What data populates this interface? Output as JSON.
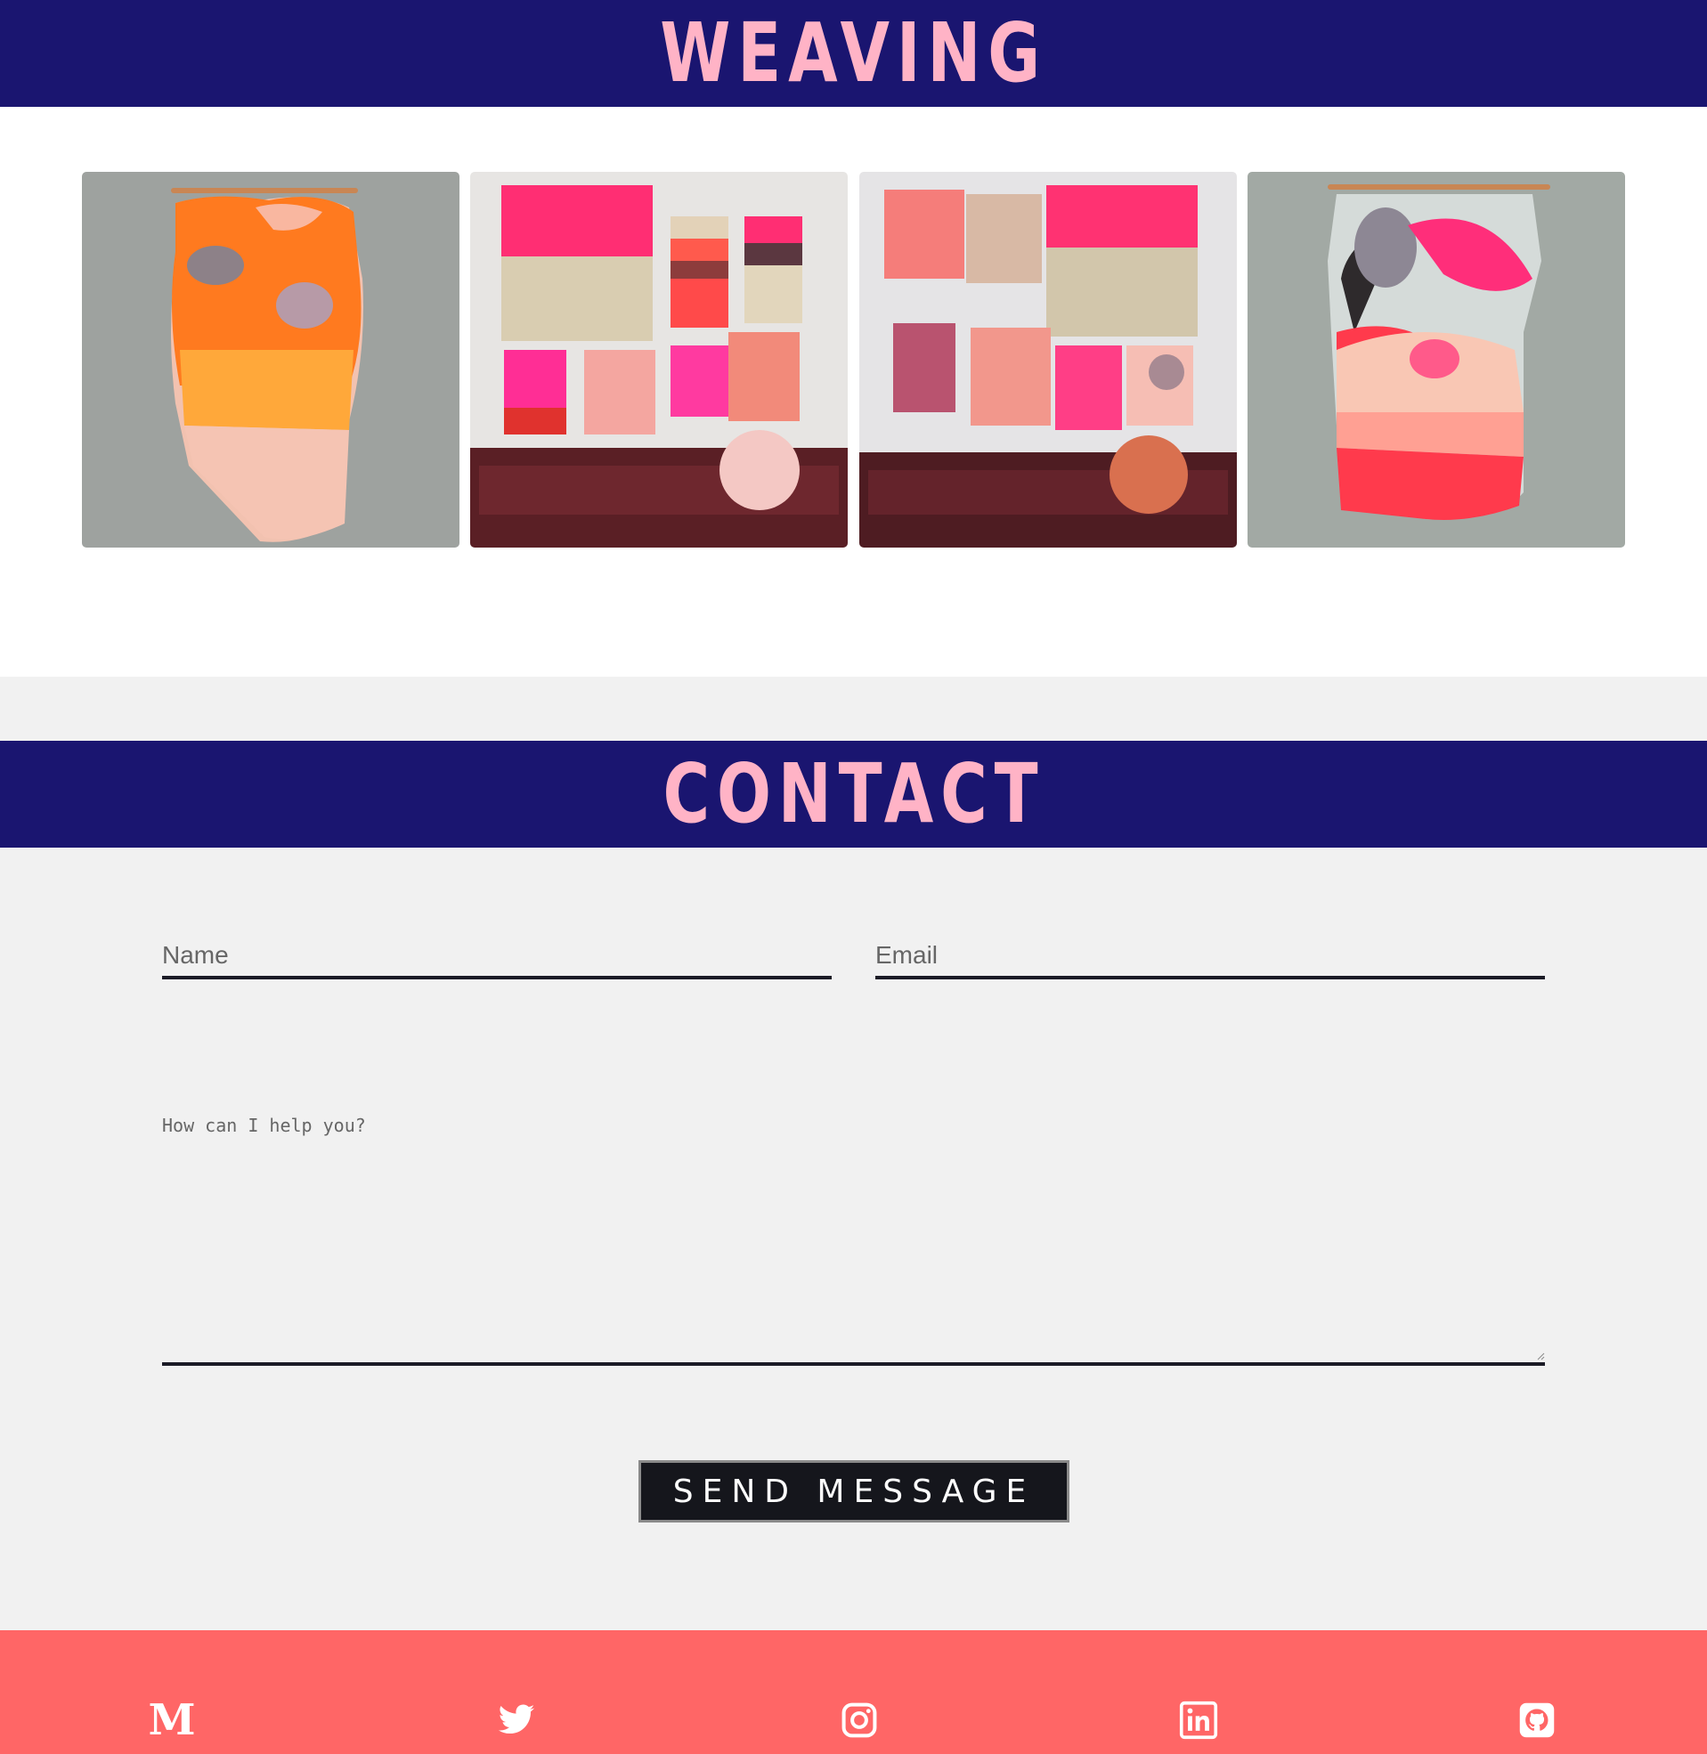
{
  "weaving": {
    "title": "WEAVING",
    "gallery": [
      {
        "name": "orange-wall-hanging-image",
        "icon": "weaving-orange"
      },
      {
        "name": "pink-wall-arrangement-sofa-image",
        "icon": "weaving-pink-sofa"
      },
      {
        "name": "mixed-wall-arrangement-sofa-image",
        "icon": "weaving-mixed-sofa"
      },
      {
        "name": "red-pink-wall-hanging-image",
        "icon": "weaving-red"
      }
    ]
  },
  "contact": {
    "title": "CONTACT",
    "name_placeholder": "Name",
    "email_placeholder": "Email",
    "message_placeholder": "How can I help you?",
    "send_label": "SEND MESSAGE"
  },
  "footer": {
    "social": [
      {
        "icon": "medium-icon",
        "glyph": "M"
      },
      {
        "icon": "twitter-icon"
      },
      {
        "icon": "instagram-icon"
      },
      {
        "icon": "linkedin-icon"
      },
      {
        "icon": "github-icon"
      }
    ]
  },
  "colors": {
    "banner": "#1a1570",
    "banner_text": "#ffb3c6",
    "contact_bg": "#f1f1f1",
    "footer": "#ff6666",
    "button": "#15161c"
  }
}
